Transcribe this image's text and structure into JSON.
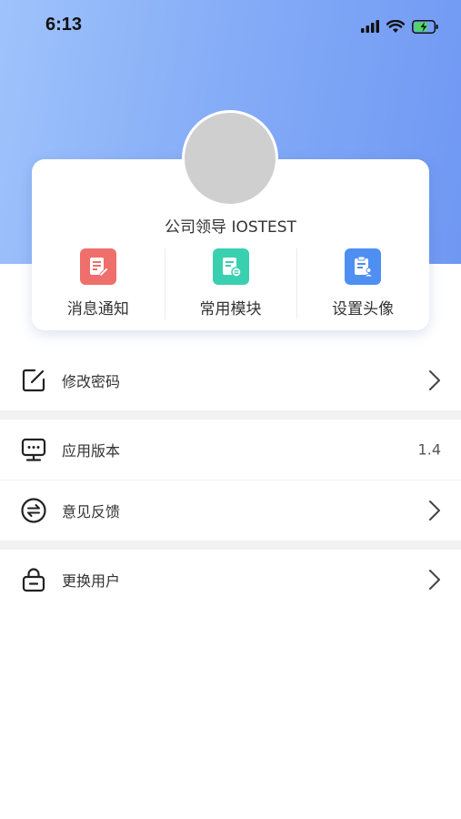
{
  "status_bar": {
    "time": "6:13"
  },
  "profile": {
    "name": "公司领导 IOSTEST"
  },
  "actions": [
    {
      "label": "消息通知",
      "icon": "message-edit-icon",
      "color": "#ee6f6b"
    },
    {
      "label": "常用模块",
      "icon": "module-doc-icon",
      "color": "#39d0b0"
    },
    {
      "label": "设置头像",
      "icon": "avatar-clipboard-icon",
      "color": "#4f8ff2"
    }
  ],
  "menu": {
    "change_password": {
      "label": "修改密码",
      "icon": "edit-square-icon"
    },
    "app_version": {
      "label": "应用版本",
      "icon": "monitor-chat-icon",
      "value": "1.4"
    },
    "feedback": {
      "label": "意见反馈",
      "icon": "exchange-circle-icon"
    },
    "switch_user": {
      "label": "更换用户",
      "icon": "lock-icon"
    }
  },
  "colors": {
    "hero_gradient_start": "#9fc3fb",
    "hero_gradient_end": "#6f98f3",
    "separator": "#f2f2f2"
  }
}
